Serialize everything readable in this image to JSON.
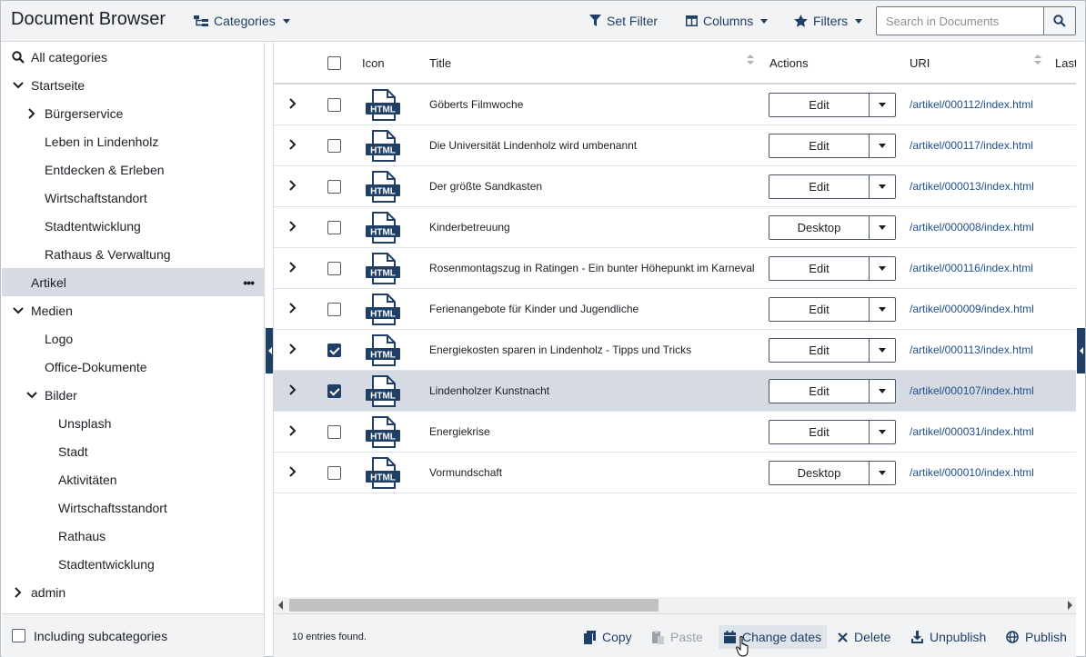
{
  "header": {
    "title": "Document Browser",
    "categories_label": "Categories",
    "set_filter_label": "Set Filter",
    "columns_label": "Columns",
    "filters_label": "Filters",
    "search_placeholder": "Search in Documents"
  },
  "sidebar": {
    "items": [
      {
        "label": "All categories",
        "icon": "search-icon",
        "level": 0
      },
      {
        "label": "Startseite",
        "icon": "chevron-down-icon",
        "level": 0
      },
      {
        "label": "Bürgerservice",
        "icon": "chevron-right-icon",
        "level": 1
      },
      {
        "label": "Leben in Lindenholz",
        "icon": "",
        "level": 1
      },
      {
        "label": "Entdecken & Erleben",
        "icon": "",
        "level": 1
      },
      {
        "label": "Wirtschaftstandort",
        "icon": "",
        "level": 1
      },
      {
        "label": "Stadtentwicklung",
        "icon": "",
        "level": 1
      },
      {
        "label": "Rathaus & Verwaltung",
        "icon": "",
        "level": 1
      },
      {
        "label": "Artikel",
        "icon": "",
        "level": 0,
        "active": true
      },
      {
        "label": "Medien",
        "icon": "chevron-down-icon",
        "level": 0
      },
      {
        "label": "Logo",
        "icon": "",
        "level": 1
      },
      {
        "label": "Office-Dokumente",
        "icon": "",
        "level": 1
      },
      {
        "label": "Bilder",
        "icon": "chevron-down-icon",
        "level": 1
      },
      {
        "label": "Unsplash",
        "icon": "",
        "level": 2
      },
      {
        "label": "Stadt",
        "icon": "",
        "level": 2
      },
      {
        "label": "Aktivitäten",
        "icon": "",
        "level": 2
      },
      {
        "label": "Wirtschaftsstandort",
        "icon": "",
        "level": 2
      },
      {
        "label": "Rathaus",
        "icon": "",
        "level": 2
      },
      {
        "label": "Stadtentwicklung",
        "icon": "",
        "level": 2
      },
      {
        "label": "admin",
        "icon": "chevron-right-icon",
        "level": 0
      }
    ],
    "footer_label": "Including subcategories"
  },
  "table": {
    "columns": {
      "icon": "Icon",
      "title": "Title",
      "actions": "Actions",
      "uri": "URI",
      "last": "Last"
    },
    "icon_text": "HTML",
    "rows": [
      {
        "title": "Göberts Filmwoche",
        "action": "Edit",
        "uri": "/artikel/000112/index.html",
        "checked": false,
        "selected": false
      },
      {
        "title": "Die Universität Lindenholz wird umbenannt",
        "action": "Edit",
        "uri": "/artikel/000117/index.html",
        "checked": false,
        "selected": false
      },
      {
        "title": "Der größte Sandkasten",
        "action": "Edit",
        "uri": "/artikel/000013/index.html",
        "checked": false,
        "selected": false
      },
      {
        "title": "Kinderbetreuung",
        "action": "Desktop",
        "uri": "/artikel/000008/index.html",
        "checked": false,
        "selected": false
      },
      {
        "title": "Rosenmontagszug in Ratingen - Ein bunter Höhepunkt im Karneval",
        "action": "Edit",
        "uri": "/artikel/000116/index.html",
        "checked": false,
        "selected": false
      },
      {
        "title": "Ferienangebote für Kinder und Jugendliche",
        "action": "Edit",
        "uri": "/artikel/000009/index.html",
        "checked": false,
        "selected": false
      },
      {
        "title": "Energiekosten sparen in Lindenholz - Tipps und Tricks",
        "action": "Edit",
        "uri": "/artikel/000113/index.html",
        "checked": true,
        "selected": false
      },
      {
        "title": "Lindenholzer Kunstnacht",
        "action": "Edit",
        "uri": "/artikel/000107/index.html",
        "checked": true,
        "selected": true
      },
      {
        "title": "Energiekrise",
        "action": "Edit",
        "uri": "/artikel/000031/index.html",
        "checked": false,
        "selected": false
      },
      {
        "title": "Vormundschaft",
        "action": "Desktop",
        "uri": "/artikel/000010/index.html",
        "checked": false,
        "selected": false
      }
    ]
  },
  "footer": {
    "entries_text": "10 entries found.",
    "copy_label": "Copy",
    "paste_label": "Paste",
    "change_dates_label": "Change dates",
    "delete_label": "Delete",
    "unpublish_label": "Unpublish",
    "publish_label": "Publish"
  },
  "colors": {
    "accent": "#1f3f66",
    "link": "#1f4f8a",
    "selected_row": "#d6dae3",
    "header_bg": "#f2f3f5"
  }
}
